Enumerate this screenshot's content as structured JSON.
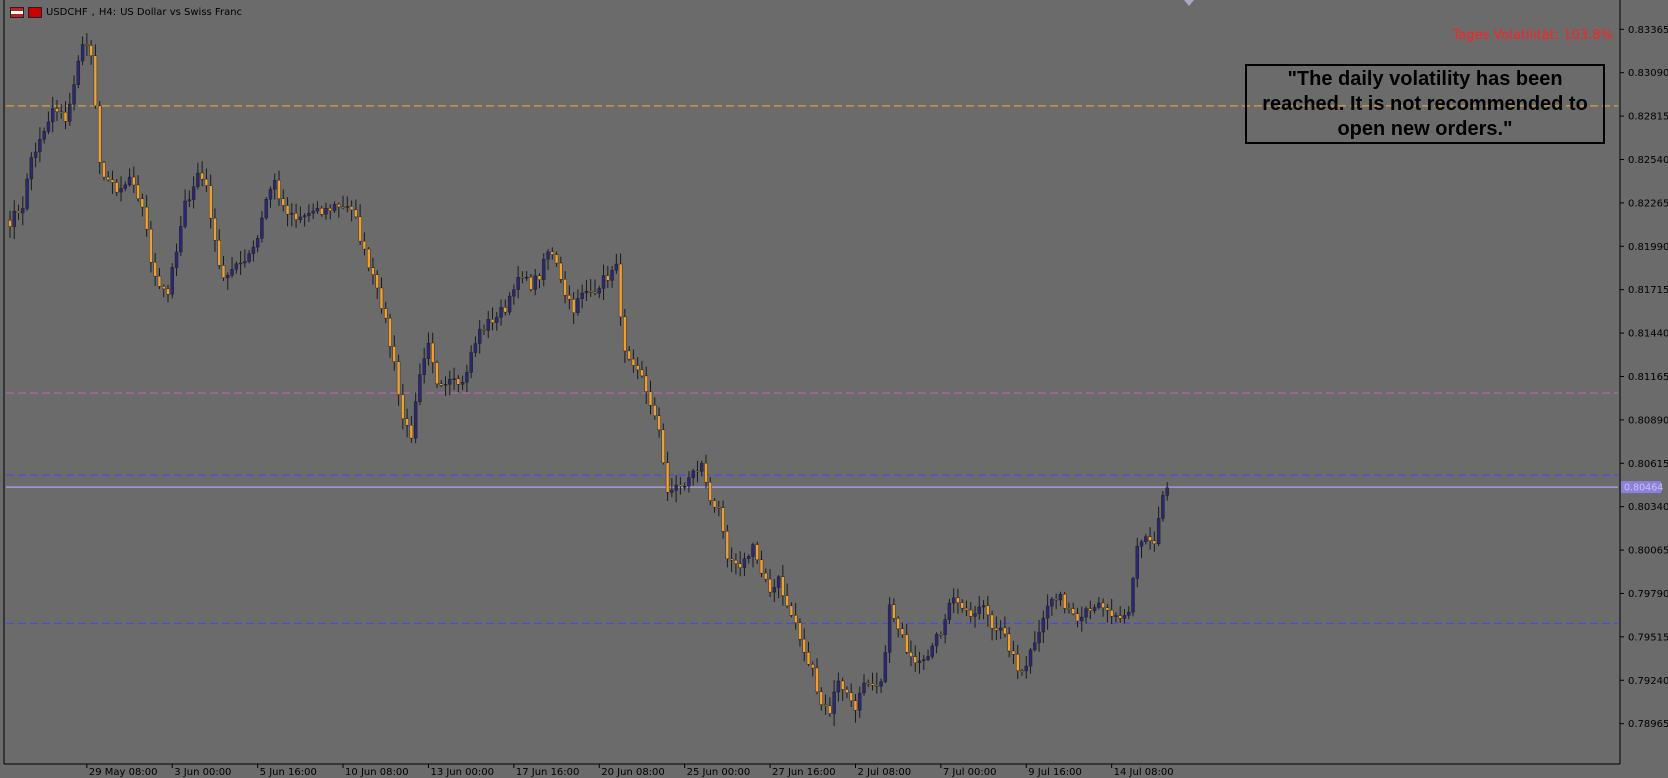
{
  "header": {
    "symbol": "USDCHF",
    "timeframe": "H4:",
    "description": "US Dollar vs Swiss Franc"
  },
  "volatility_label": "Tages Volatilität: 103.8%",
  "message": "\"The daily volatility has been reached. It is not recommended to open new orders.\"",
  "current_price_label": "0.80464",
  "colors": {
    "background": "#6b6b6b",
    "bull_candle": "#2a2870",
    "bear_candle": "#f0a030",
    "wick": "#1a1a1a",
    "grid_text": "#000000",
    "volatility_text": "#ff2020",
    "orange_line": "#d9a040",
    "magenta_line": "#c060c0",
    "blue_line": "#4a4ae0",
    "price_line": "#b0a0ff"
  },
  "chart_data": {
    "type": "candlestick",
    "title": "",
    "xlabel": "",
    "ylabel": "",
    "ylim": [
      0.7876,
      0.835
    ],
    "y_ticks": [
      0.83365,
      0.8309,
      0.82815,
      0.8254,
      0.82265,
      0.8199,
      0.81715,
      0.8144,
      0.81165,
      0.8089,
      0.80615,
      0.8034,
      0.80065,
      0.7979,
      0.79515,
      0.7924,
      0.78965
    ],
    "x_labels": [
      {
        "index": 18,
        "label": "29 May 08:00"
      },
      {
        "index": 38,
        "label": "3 Jun 00:00"
      },
      {
        "index": 58,
        "label": "5 Jun 16:00"
      },
      {
        "index": 78,
        "label": "10 Jun 08:00"
      },
      {
        "index": 98,
        "label": "13 Jun 00:00"
      },
      {
        "index": 118,
        "label": "17 Jun 16:00"
      },
      {
        "index": 138,
        "label": "20 Jun 08:00"
      },
      {
        "index": 158,
        "label": "25 Jun 00:00"
      },
      {
        "index": 178,
        "label": "27 Jun 16:00"
      },
      {
        "index": 198,
        "label": "2 Jul 08:00"
      },
      {
        "index": 218,
        "label": "7 Jul 00:00"
      },
      {
        "index": 238,
        "label": "9 Jul 16:00"
      },
      {
        "index": 258,
        "label": "14 Jul 08:00"
      }
    ],
    "horizontal_lines": [
      {
        "value": 0.8288,
        "style": "dashed",
        "color": "#d9a040"
      },
      {
        "value": 0.8106,
        "style": "dashed",
        "color": "#c060c0"
      },
      {
        "value": 0.8054,
        "style": "dashed",
        "color": "#4a4ae0"
      },
      {
        "value": 0.796,
        "style": "dashed",
        "color": "#4a4ae0"
      },
      {
        "value": 0.80464,
        "style": "solid",
        "color": "#b0a0ff"
      }
    ],
    "anchors": [
      [
        0,
        0.8215
      ],
      [
        3,
        0.8225
      ],
      [
        5,
        0.8255
      ],
      [
        8,
        0.827
      ],
      [
        10,
        0.8285
      ],
      [
        13,
        0.828
      ],
      [
        15,
        0.83
      ],
      [
        17,
        0.833
      ],
      [
        19,
        0.832
      ],
      [
        21,
        0.825
      ],
      [
        25,
        0.8232
      ],
      [
        28,
        0.824
      ],
      [
        31,
        0.8225
      ],
      [
        33,
        0.819
      ],
      [
        35,
        0.8175
      ],
      [
        37,
        0.817
      ],
      [
        39,
        0.8195
      ],
      [
        41,
        0.8225
      ],
      [
        44,
        0.8245
      ],
      [
        46,
        0.8238
      ],
      [
        48,
        0.82
      ],
      [
        50,
        0.818
      ],
      [
        53,
        0.8185
      ],
      [
        56,
        0.8195
      ],
      [
        58,
        0.8205
      ],
      [
        60,
        0.823
      ],
      [
        62,
        0.824
      ],
      [
        64,
        0.8222
      ],
      [
        67,
        0.8215
      ],
      [
        70,
        0.822
      ],
      [
        73,
        0.822
      ],
      [
        76,
        0.8225
      ],
      [
        79,
        0.8225
      ],
      [
        81,
        0.8215
      ],
      [
        83,
        0.8195
      ],
      [
        86,
        0.8175
      ],
      [
        88,
        0.815
      ],
      [
        90,
        0.8125
      ],
      [
        92,
        0.809
      ],
      [
        94,
        0.808
      ],
      [
        96,
        0.8115
      ],
      [
        98,
        0.8135
      ],
      [
        100,
        0.811
      ],
      [
        102,
        0.8115
      ],
      [
        104,
        0.8118
      ],
      [
        106,
        0.8112
      ],
      [
        108,
        0.813
      ],
      [
        110,
        0.8145
      ],
      [
        112,
        0.815
      ],
      [
        114,
        0.8155
      ],
      [
        116,
        0.816
      ],
      [
        118,
        0.8175
      ],
      [
        120,
        0.8178
      ],
      [
        122,
        0.8175
      ],
      [
        124,
        0.818
      ],
      [
        126,
        0.8195
      ],
      [
        128,
        0.819
      ],
      [
        130,
        0.817
      ],
      [
        132,
        0.816
      ],
      [
        134,
        0.8168
      ],
      [
        136,
        0.817
      ],
      [
        138,
        0.8175
      ],
      [
        140,
        0.818
      ],
      [
        142,
        0.8185
      ],
      [
        144,
        0.813
      ],
      [
        146,
        0.812
      ],
      [
        148,
        0.8115
      ],
      [
        150,
        0.81
      ],
      [
        152,
        0.808
      ],
      [
        154,
        0.8045
      ],
      [
        156,
        0.8045
      ],
      [
        158,
        0.8048
      ],
      [
        160,
        0.8055
      ],
      [
        162,
        0.806
      ],
      [
        164,
        0.804
      ],
      [
        166,
        0.803
      ],
      [
        168,
        0.8
      ],
      [
        170,
        0.7995
      ],
      [
        172,
        0.8
      ],
      [
        174,
        0.801
      ],
      [
        176,
        0.799
      ],
      [
        178,
        0.798
      ],
      [
        180,
        0.799
      ],
      [
        182,
        0.797
      ],
      [
        184,
        0.796
      ],
      [
        186,
        0.794
      ],
      [
        188,
        0.793
      ],
      [
        190,
        0.791
      ],
      [
        192,
        0.7905
      ],
      [
        194,
        0.7925
      ],
      [
        196,
        0.7915
      ],
      [
        198,
        0.7908
      ],
      [
        200,
        0.792
      ],
      [
        202,
        0.7918
      ],
      [
        204,
        0.792
      ],
      [
        206,
        0.797
      ],
      [
        208,
        0.7955
      ],
      [
        210,
        0.7945
      ],
      [
        212,
        0.7938
      ],
      [
        214,
        0.794
      ],
      [
        216,
        0.7945
      ],
      [
        218,
        0.7955
      ],
      [
        220,
        0.7975
      ],
      [
        222,
        0.7975
      ],
      [
        224,
        0.7965
      ],
      [
        226,
        0.7965
      ],
      [
        228,
        0.7972
      ],
      [
        230,
        0.796
      ],
      [
        232,
        0.7955
      ],
      [
        234,
        0.7945
      ],
      [
        236,
        0.793
      ],
      [
        238,
        0.7935
      ],
      [
        240,
        0.795
      ],
      [
        242,
        0.7965
      ],
      [
        244,
        0.7975
      ],
      [
        246,
        0.7975
      ],
      [
        248,
        0.797
      ],
      [
        250,
        0.7965
      ],
      [
        252,
        0.797
      ],
      [
        254,
        0.7972
      ],
      [
        256,
        0.7968
      ],
      [
        258,
        0.7965
      ],
      [
        260,
        0.796
      ],
      [
        262,
        0.7966
      ],
      [
        264,
        0.801
      ],
      [
        266,
        0.8015
      ],
      [
        268,
        0.801
      ],
      [
        270,
        0.804
      ],
      [
        271,
        0.8046
      ]
    ]
  }
}
